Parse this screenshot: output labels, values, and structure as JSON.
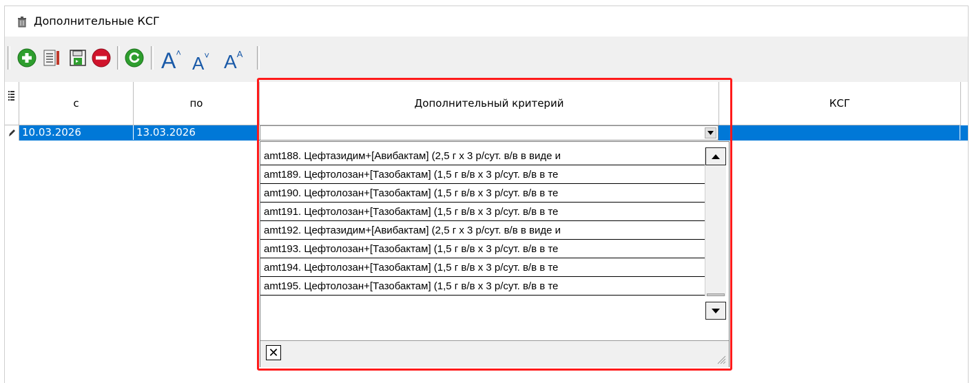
{
  "window": {
    "title": "Дополнительные КСГ"
  },
  "toolbar": {
    "buttons": [
      {
        "name": "add",
        "icon": "plus-circle-icon",
        "color": "#2e9e2e"
      },
      {
        "name": "edit",
        "icon": "edit-list-icon"
      },
      {
        "name": "save",
        "icon": "save-icon",
        "color": "#2e8b57"
      },
      {
        "name": "delete",
        "icon": "minus-circle-icon",
        "color": "#d0142c"
      },
      {
        "name": "refresh",
        "icon": "refresh-icon",
        "color": "#2e9e2e"
      },
      {
        "name": "font-increase",
        "icon": "font-increase-icon"
      },
      {
        "name": "font-decrease",
        "icon": "font-decrease-icon"
      },
      {
        "name": "font-size",
        "icon": "font-size-icon"
      }
    ]
  },
  "grid": {
    "columns": [
      "с",
      "по",
      "Дополнительный критерий",
      "КСГ"
    ],
    "rows": [
      {
        "from": "10.03.2026",
        "to": "13.03.2026",
        "criterion": "",
        "ksg": ""
      }
    ]
  },
  "dropdown": {
    "options": [
      "amt188. Цефтазидим+[Авибактам] (2,5 г х 3 р/сут. в/в в виде и",
      "amt189. Цефтолозан+[Тазобактам] (1,5 г в/в х 3 р/сут. в/в в те",
      "amt190. Цефтолозан+[Тазобактам] (1,5 г в/в х 3 р/сут. в/в в те",
      "amt191. Цефтолозан+[Тазобактам] (1,5 г в/в х 3 р/сут. в/в в те",
      "amt192. Цефтазидим+[Авибактам] (2,5 г х 3 р/сут. в/в в виде и",
      "amt193. Цефтолозан+[Тазобактам] (1,5 г в/в х 3 р/сут. в/в в те",
      "amt194. Цефтолозан+[Тазобактам] (1,5 г в/в х 3 р/сут. в/в в те",
      "amt195. Цефтолозан+[Тазобактам] (1,5 г в/в х 3 р/сут. в/в в те"
    ],
    "clear_button": "✕"
  },
  "colors": {
    "selection": "#0078d7",
    "highlight": "#ff1a1a"
  }
}
